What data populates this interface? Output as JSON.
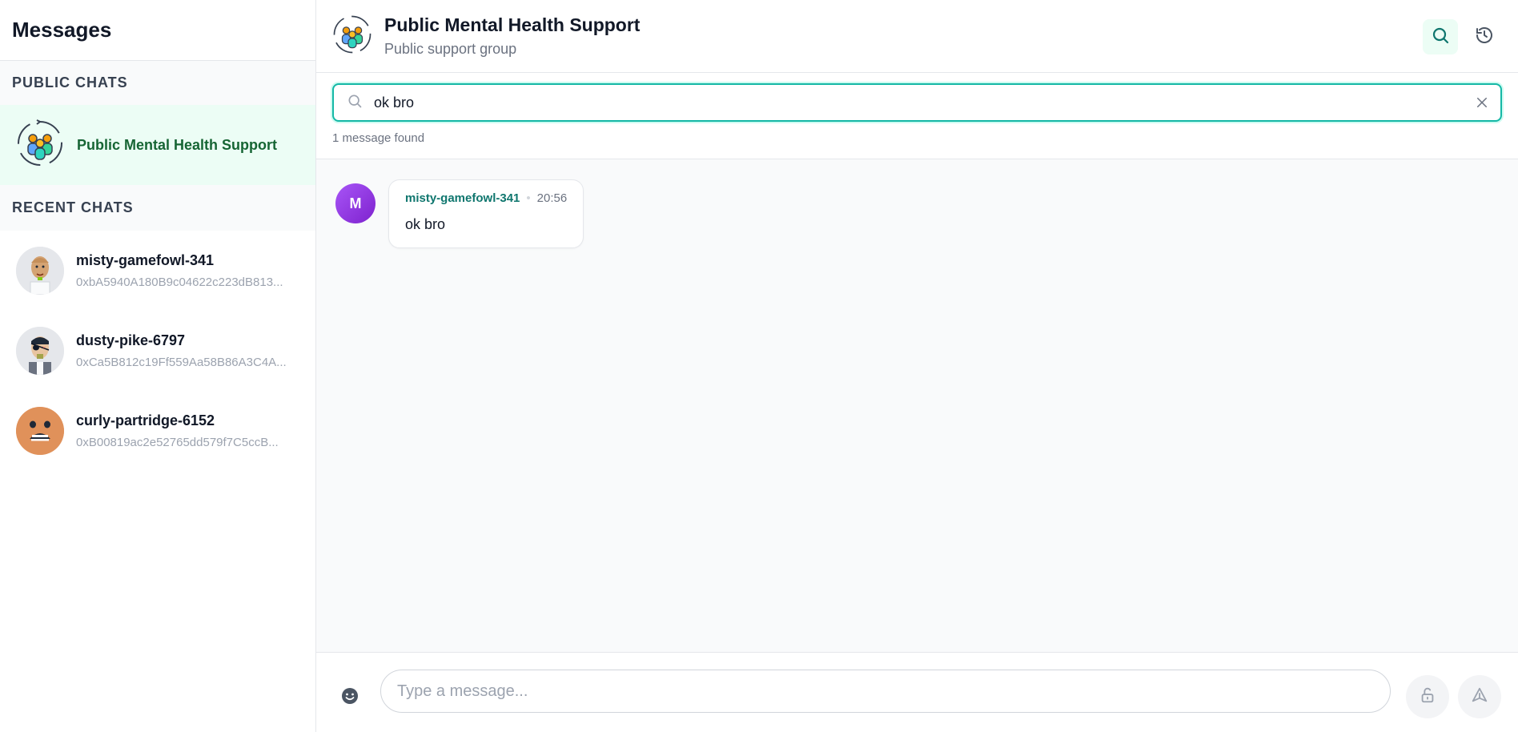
{
  "sidebar": {
    "title": "Messages",
    "public_label": "PUBLIC CHATS",
    "public_chat": {
      "name": "Public Mental Health Support"
    },
    "recent_label": "RECENT CHATS",
    "recent_chats": [
      {
        "name": "misty-gamefowl-341",
        "address": "0xbA5940A180B9c04622c223dB813...",
        "avatar": "bald-man-avatar-icon"
      },
      {
        "name": "dusty-pike-6797",
        "address": "0xCa5B812c19Ff559Aa58B86A3C4A...",
        "avatar": "eyepatch-man-avatar-icon"
      },
      {
        "name": "curly-partridge-6152",
        "address": "0xB00819ac2e52765dd579f7C5ccB...",
        "avatar": "scared-face-avatar-icon"
      }
    ]
  },
  "header": {
    "title": "Public Mental Health Support",
    "subtitle": "Public support group",
    "group_icon": "group-people-icon",
    "search_icon": "search-icon",
    "history_icon": "history-icon"
  },
  "search": {
    "value": "ok bro",
    "result_text": "1 message found"
  },
  "messages": [
    {
      "initial": "M",
      "author": "misty-gamefowl-341",
      "time": "20:56",
      "text": "ok bro"
    }
  ],
  "composer": {
    "placeholder": "Type a message...",
    "emoji_icon": "emoji-icon",
    "lock_icon": "unlock-icon",
    "send_icon": "send-icon"
  },
  "colors": {
    "accent": "#14b8a6",
    "public_highlight": "#ecfdf5",
    "public_text": "#166534",
    "author": "#0f766e",
    "avatar_purple": "#9333ea"
  }
}
